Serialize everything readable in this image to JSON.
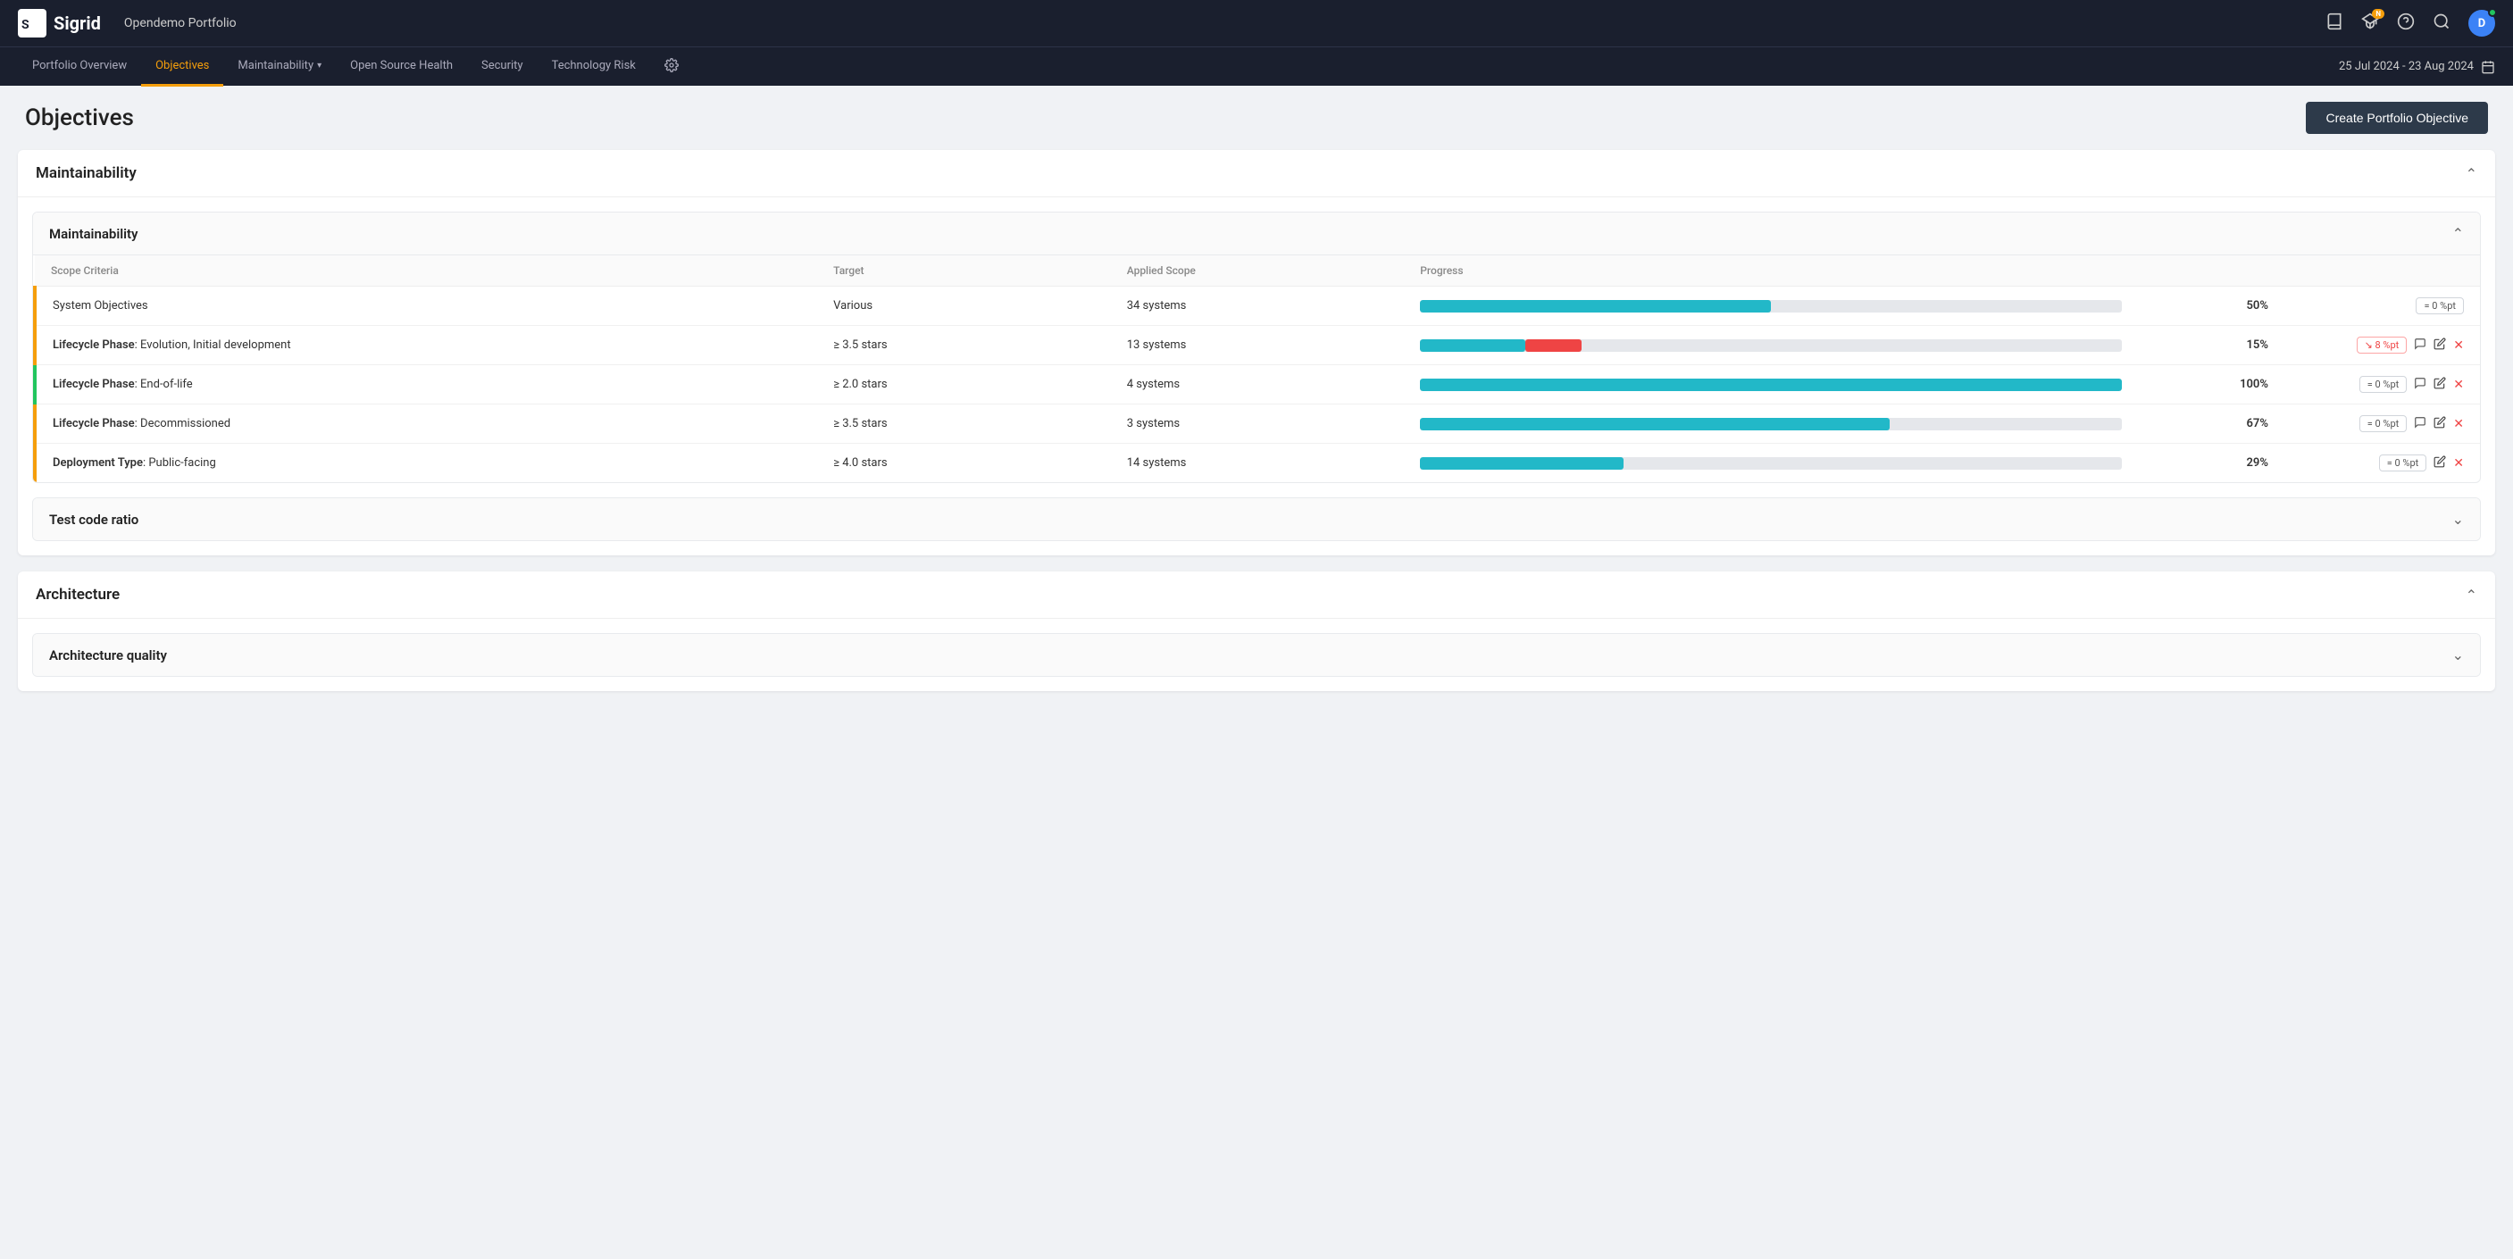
{
  "topbar": {
    "logo_text": "Sigrid",
    "app_name": "Opendemo Portfolio",
    "icons": [
      "book",
      "graduation",
      "help",
      "search"
    ],
    "avatar_initials": "D"
  },
  "subnav": {
    "items": [
      {
        "label": "Portfolio Overview",
        "active": false
      },
      {
        "label": "Objectives",
        "active": true
      },
      {
        "label": "Maintainability",
        "dropdown": true,
        "active": false
      },
      {
        "label": "Open Source Health",
        "active": false
      },
      {
        "label": "Security",
        "active": false
      },
      {
        "label": "Technology Risk",
        "active": false
      }
    ],
    "date_range": "25 Jul 2024 - 23 Aug 2024",
    "settings_label": "Settings"
  },
  "page": {
    "title": "Objectives",
    "create_button_label": "Create Portfolio Objective"
  },
  "sections": [
    {
      "id": "maintainability",
      "title": "Maintainability",
      "expanded": true,
      "objectives": [
        {
          "id": "maintainability-inner",
          "title": "Maintainability",
          "expanded": true,
          "columns": [
            "Scope Criteria",
            "Target",
            "Applied Scope",
            "Progress"
          ],
          "rows": [
            {
              "scope": "System Objectives",
              "scope_bold": false,
              "target": "Various",
              "applied_scope": "34 systems",
              "progress_pct": 50,
              "progress_fill_pct": 50,
              "progress_color": "teal",
              "has_red": false,
              "display_pct": "50%",
              "badge": "= 0 %pt",
              "badge_type": "neutral",
              "show_comment": false,
              "show_edit": false,
              "show_delete": false,
              "left_border": "yellow"
            },
            {
              "scope": "Lifecycle Phase",
              "scope_suffix": ": Evolution, Initial development",
              "scope_bold": true,
              "target": "≥ 3.5 stars",
              "applied_scope": "13 systems",
              "progress_pct": 15,
              "progress_fill_pct": 15,
              "progress_color": "teal",
              "has_red": true,
              "red_pct": 8,
              "display_pct": "15%",
              "badge": "↘ 8 %pt",
              "badge_type": "red",
              "show_comment": true,
              "show_edit": true,
              "show_delete": true,
              "left_border": "yellow"
            },
            {
              "scope": "Lifecycle Phase",
              "scope_suffix": ": End-of-life",
              "scope_bold": true,
              "target": "≥ 2.0 stars",
              "applied_scope": "4 systems",
              "progress_pct": 100,
              "progress_fill_pct": 100,
              "progress_color": "teal",
              "has_red": false,
              "display_pct": "100%",
              "badge": "= 0 %pt",
              "badge_type": "neutral",
              "show_comment": true,
              "show_edit": true,
              "show_delete": true,
              "left_border": "green"
            },
            {
              "scope": "Lifecycle Phase",
              "scope_suffix": ": Decommissioned",
              "scope_bold": true,
              "target": "≥ 3.5 stars",
              "applied_scope": "3 systems",
              "progress_pct": 67,
              "progress_fill_pct": 67,
              "progress_color": "teal",
              "has_red": false,
              "display_pct": "67%",
              "badge": "= 0 %pt",
              "badge_type": "neutral",
              "show_comment": true,
              "show_edit": true,
              "show_delete": true,
              "left_border": "yellow"
            },
            {
              "scope": "Deployment Type",
              "scope_suffix": ": Public-facing",
              "scope_bold": true,
              "target": "≥ 4.0 stars",
              "applied_scope": "14 systems",
              "progress_pct": 29,
              "progress_fill_pct": 29,
              "progress_color": "teal",
              "has_red": false,
              "display_pct": "29%",
              "badge": "= 0 %pt",
              "badge_type": "neutral",
              "show_comment": false,
              "show_edit": true,
              "show_delete": true,
              "left_border": "yellow"
            }
          ]
        },
        {
          "id": "test-code-ratio",
          "title": "Test code ratio",
          "expanded": false
        }
      ]
    },
    {
      "id": "architecture",
      "title": "Architecture",
      "expanded": true,
      "objectives": [
        {
          "id": "architecture-quality",
          "title": "Architecture quality",
          "expanded": false
        }
      ]
    }
  ],
  "colors": {
    "yellow_border": "#f59e0b",
    "green_border": "#22c55e",
    "teal_progress": "#22b8c8",
    "red_progress": "#ef4444",
    "progress_bg": "#e5e7eb"
  }
}
